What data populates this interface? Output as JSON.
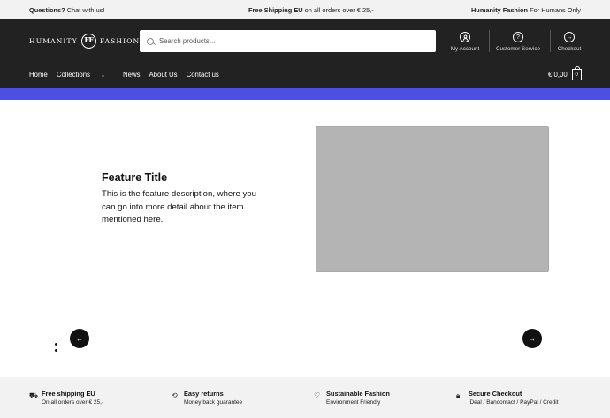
{
  "topbar": {
    "left_bold": "Questions?",
    "left_text": " Chat with us!",
    "center_bold": "Free Shipping EU",
    "center_text": " on all orders over € 25,-",
    "right_bold": "Humanity Fashion",
    "right_text": " For Humans Only"
  },
  "header": {
    "logo_left": "HUMANITY",
    "logo_mark": "FF",
    "logo_right": "FASHION",
    "search_placeholder": "Search products...",
    "icons": [
      {
        "label": "My Account",
        "icon": "user-icon"
      },
      {
        "label": "Customer Service",
        "icon": "help-icon"
      },
      {
        "label": "Checkout",
        "icon": "arrow-right-circle-icon"
      }
    ]
  },
  "nav": {
    "items": [
      "Home",
      "Collections",
      "News",
      "About Us",
      "Contact us"
    ],
    "collections_chevron": "⌄",
    "cart_total": "€ 0,00",
    "cart_count": "0"
  },
  "colors": {
    "accent": "#4d4fe0",
    "header_bg": "#222222",
    "topbar_bg": "#f2f2f2"
  },
  "slider": {
    "title": "Feature Title",
    "description": "This is the feature description, where you can go into more detail about the item mentioned here.",
    "prev_glyph": "←",
    "next_glyph": "→"
  },
  "usps": [
    {
      "icon": "truck-icon",
      "glyph": "⛟",
      "title": "Free shipping EU",
      "subtitle": "On all orders over € 25,-"
    },
    {
      "icon": "returns-icon",
      "glyph": "⟲",
      "title": "Easy returns",
      "subtitle": "Money back guarantee"
    },
    {
      "icon": "heart-icon",
      "glyph": "♡",
      "title": "Sustainable Fashion",
      "subtitle": "Environment Friendly"
    },
    {
      "icon": "lock-icon",
      "glyph": "🔒︎",
      "title": "Secure Checkout",
      "subtitle": "iDeal / Bancontact / PayPal / Credit"
    }
  ]
}
